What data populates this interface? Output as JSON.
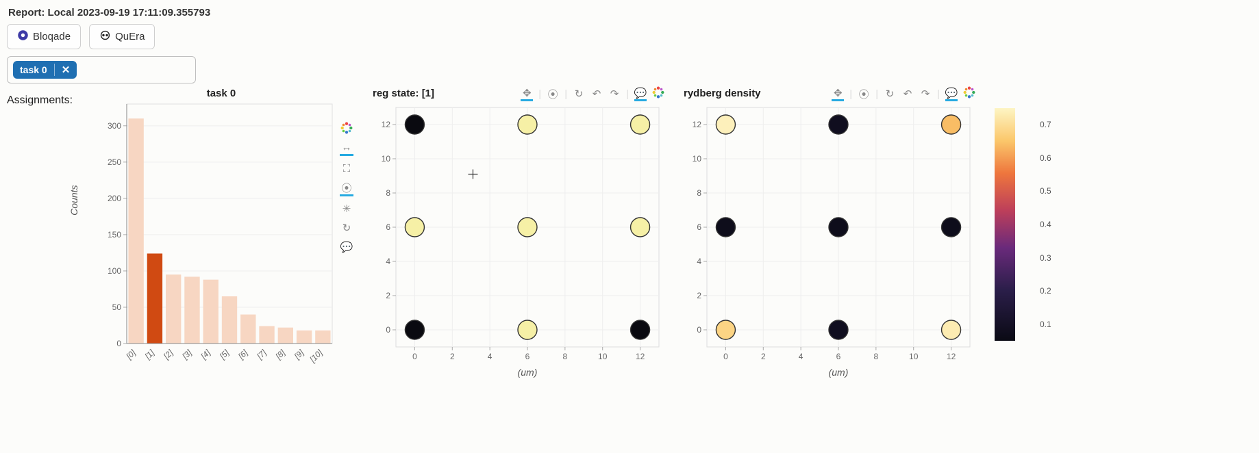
{
  "header": {
    "title": "Report: Local 2023-09-19 17:11:09.355793",
    "buttons": [
      "Bloqade",
      "QuEra"
    ],
    "selected_task": "task 0",
    "assignments_label": "Assignments:"
  },
  "colorbar": {
    "range": [
      0.05,
      0.75
    ],
    "ticks": [
      0.1,
      0.2,
      0.3,
      0.4,
      0.5,
      0.6,
      0.7
    ]
  },
  "chart_data": [
    {
      "type": "bar",
      "title": "task 0",
      "ylabel": "Counts",
      "xlabel": "",
      "ylim": [
        0,
        330
      ],
      "yticks": [
        0,
        50,
        100,
        150,
        200,
        250,
        300
      ],
      "categories": [
        "[0]",
        "[1]",
        "[2]",
        "[3]",
        "[4]",
        "[5]",
        "[6]",
        "[7]",
        "[8]",
        "[9]",
        "[10]"
      ],
      "values": [
        310,
        124,
        95,
        92,
        88,
        65,
        40,
        24,
        22,
        18,
        18
      ],
      "highlight_index": 1
    },
    {
      "type": "scatter",
      "title": "reg state: [1]",
      "xlabel": "(um)",
      "ylabel": "",
      "xlim": [
        -1,
        13
      ],
      "ylim": [
        -1,
        13
      ],
      "xticks": [
        0,
        2,
        4,
        6,
        8,
        10,
        12
      ],
      "yticks": [
        0,
        2,
        4,
        6,
        8,
        10,
        12
      ],
      "crosshair": {
        "x": 3.1,
        "y": 9.1
      },
      "points": [
        {
          "x": 0,
          "y": 0,
          "state": 0
        },
        {
          "x": 6,
          "y": 0,
          "state": 1
        },
        {
          "x": 12,
          "y": 0,
          "state": 0
        },
        {
          "x": 0,
          "y": 6,
          "state": 1
        },
        {
          "x": 6,
          "y": 6,
          "state": 1
        },
        {
          "x": 12,
          "y": 6,
          "state": 1
        },
        {
          "x": 0,
          "y": 12,
          "state": 0
        },
        {
          "x": 6,
          "y": 12,
          "state": 1
        },
        {
          "x": 12,
          "y": 12,
          "state": 1
        }
      ],
      "colors": {
        "0": "#0a0a10",
        "1": "#f6f0a6"
      }
    },
    {
      "type": "scatter",
      "title": "rydberg density",
      "xlabel": "(um)",
      "ylabel": "",
      "xlim": [
        -1,
        13
      ],
      "ylim": [
        -1,
        13
      ],
      "xticks": [
        0,
        2,
        4,
        6,
        8,
        10,
        12
      ],
      "yticks": [
        0,
        2,
        4,
        6,
        8,
        10,
        12
      ],
      "points": [
        {
          "x": 0,
          "y": 0,
          "density": 0.68
        },
        {
          "x": 6,
          "y": 0,
          "density": 0.08
        },
        {
          "x": 12,
          "y": 0,
          "density": 0.73
        },
        {
          "x": 0,
          "y": 6,
          "density": 0.07
        },
        {
          "x": 6,
          "y": 6,
          "density": 0.07
        },
        {
          "x": 12,
          "y": 6,
          "density": 0.07
        },
        {
          "x": 0,
          "y": 12,
          "density": 0.74
        },
        {
          "x": 6,
          "y": 12,
          "density": 0.08
        },
        {
          "x": 12,
          "y": 12,
          "density": 0.64
        }
      ],
      "colormap_range": [
        0.05,
        0.75
      ]
    }
  ]
}
